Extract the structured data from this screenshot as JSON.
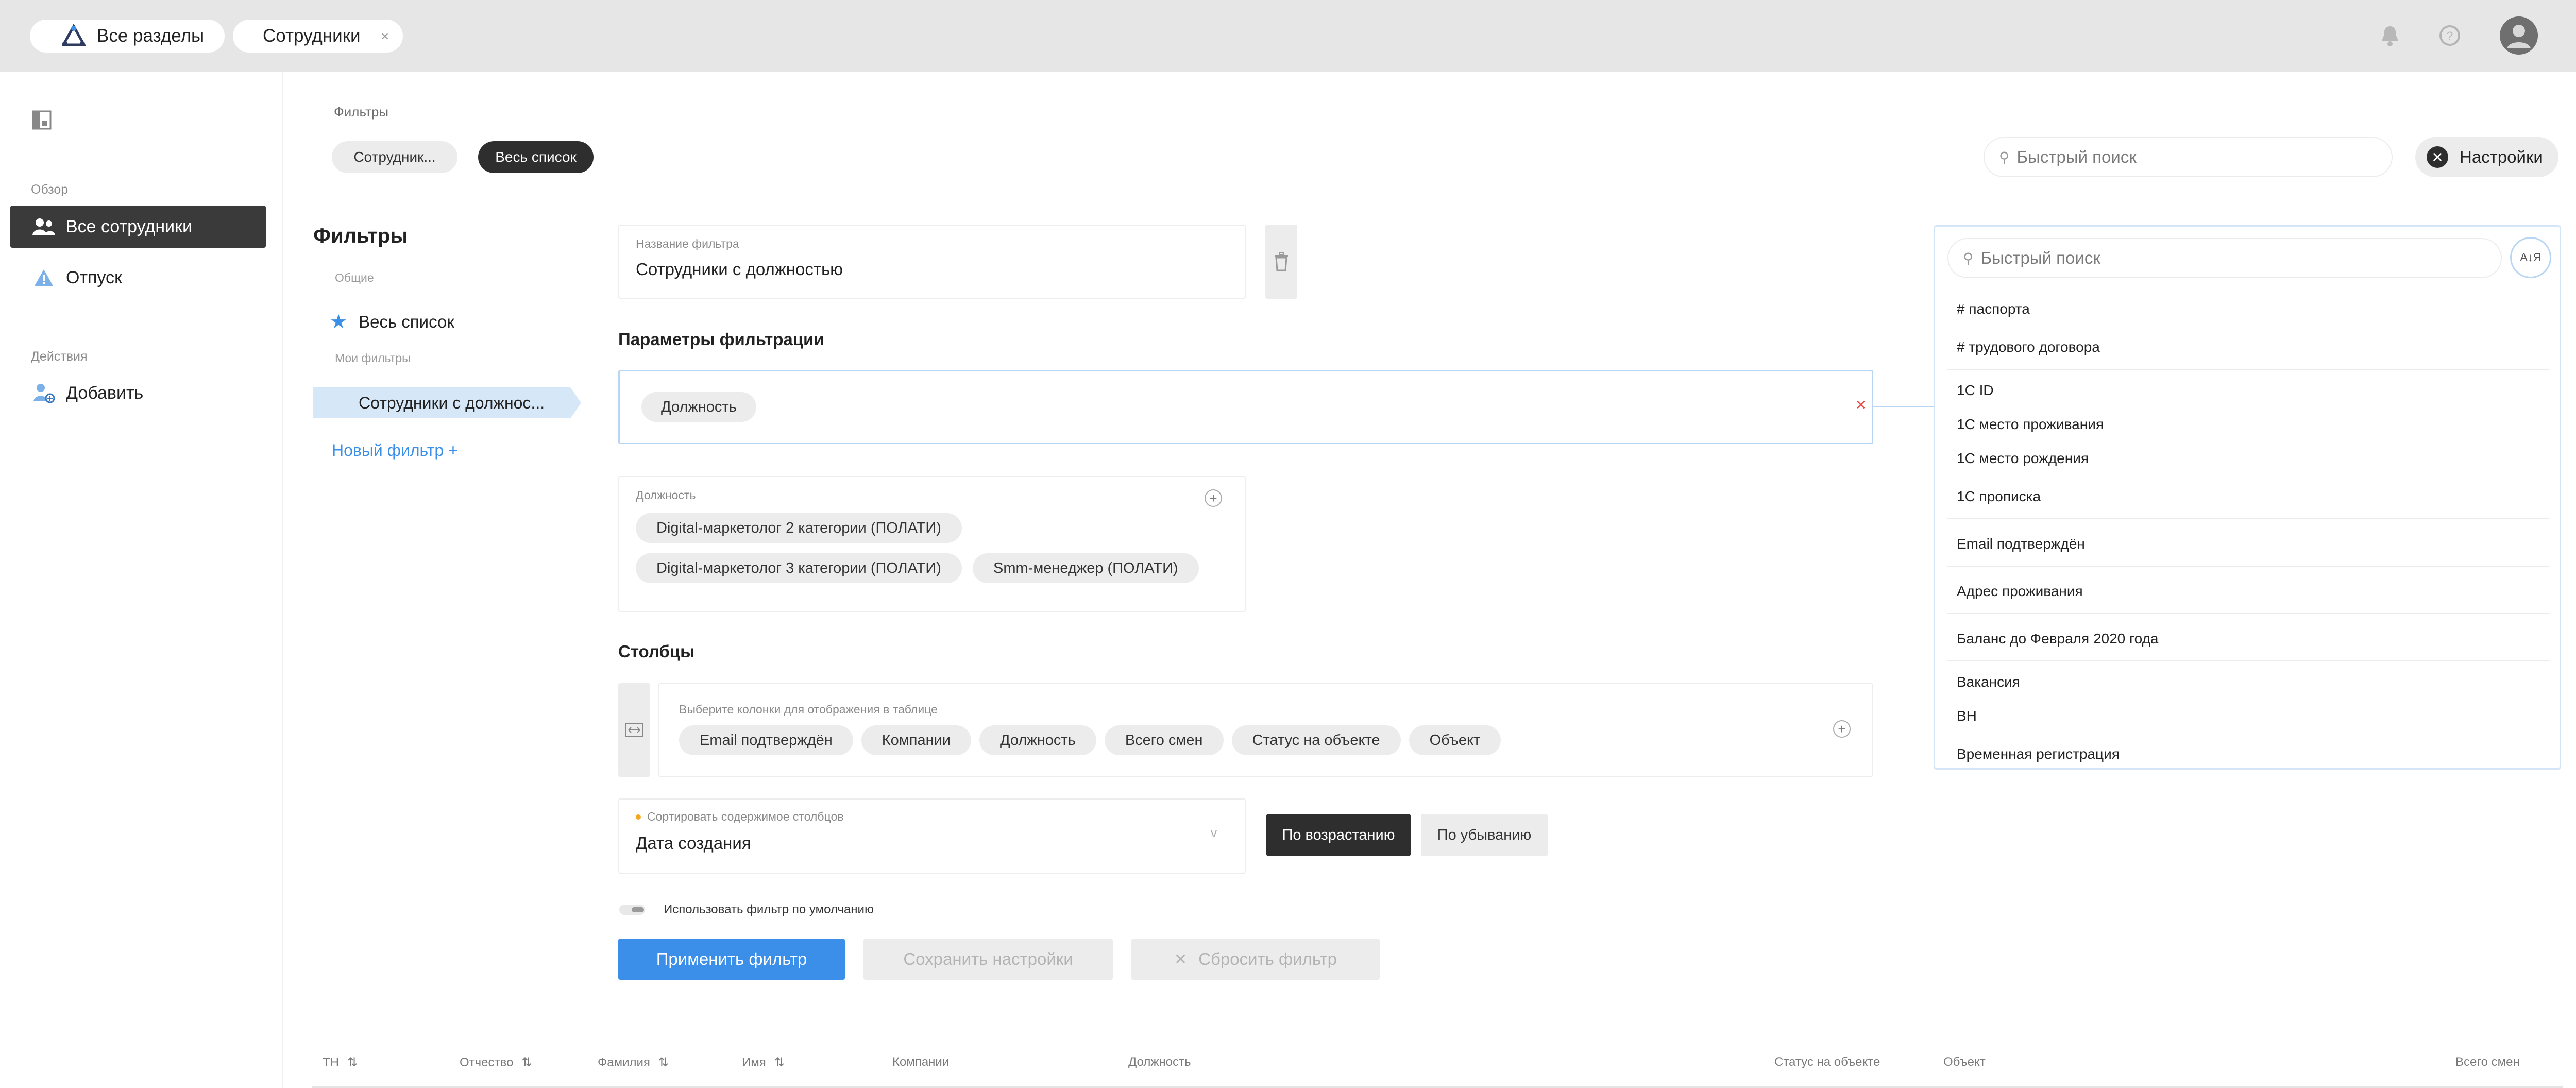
{
  "topbar": {
    "tabs": [
      {
        "label": "Все разделы"
      },
      {
        "label": "Сотрудники",
        "close": "×"
      }
    ]
  },
  "sidebar": {
    "overview_label": "Обзор",
    "actions_label": "Действия",
    "items": [
      {
        "label": "Все сотрудники",
        "icon": "users-icon",
        "active": true
      },
      {
        "label": "Отпуск",
        "icon": "warning-icon"
      },
      {
        "label": "Добавить",
        "icon": "add-user-icon"
      }
    ]
  },
  "main": {
    "breadcrumb": "Фильтры",
    "chips": [
      {
        "label": "Сотрудник..."
      },
      {
        "label": "Весь список",
        "active": true
      }
    ],
    "search_placeholder": "Быстрый поиск",
    "settings_label": "Настройки"
  },
  "filters_panel": {
    "title": "Фильтры",
    "general_label": "Общие",
    "whole_list": "Весь список",
    "my_filters_label": "Мои фильтры",
    "my_filter_item": "Сотрудники с должнос...",
    "new_filter": "Новый фильтр +"
  },
  "editor": {
    "name_label": "Название фильтра",
    "name_value": "Сотрудники с должностью",
    "params_title": "Параметры фильтрации",
    "param_chip": "Должность",
    "position_label": "Должность",
    "position_tags": [
      "Digital-маркетолог 2 категории (ПОЛАТИ)",
      "Digital-маркетолог 3 категории (ПОЛАТИ)",
      "Smm-менеджер (ПОЛАТИ)"
    ],
    "columns_title": "Столбцы",
    "columns_hint": "Выберите колонки для отображения в таблице",
    "column_tags": [
      "Email подтверждён",
      "Компании",
      "Должность",
      "Всего смен",
      "Статус на объекте",
      "Объект"
    ],
    "sort_label": "Сортировать содержимое столбцов",
    "sort_value": "Дата создания",
    "asc_label": "По возрастанию",
    "desc_label": "По убыванию",
    "default_toggle_label": "Использовать фильтр по умолчанию",
    "apply_label": "Применить фильтр",
    "save_label": "Сохранить настройки",
    "reset_label": "Сбросить фильтр"
  },
  "dropdown": {
    "search_placeholder": "Быстрый поиск",
    "sort_icon": "A↓Я",
    "items": [
      "# паспорта",
      "# трудового договора",
      "1С ID",
      "1С место проживания",
      "1С место рождения",
      "1С прописка",
      "Email подтверждён",
      "Адрес проживания",
      "Баланс до Февраля 2020 года",
      "Вакансия",
      "ВН",
      "Временная регистрация"
    ]
  },
  "table": {
    "headers": [
      "ТН",
      "Отчество",
      "Фамилия",
      "Имя",
      "Компании",
      "Должность",
      "Статус на объекте",
      "Объект",
      "Всего смен"
    ]
  },
  "colors": {
    "accent": "#3b8fe8",
    "dark": "#2e2e2e",
    "topbar": "#e6e6e6"
  }
}
